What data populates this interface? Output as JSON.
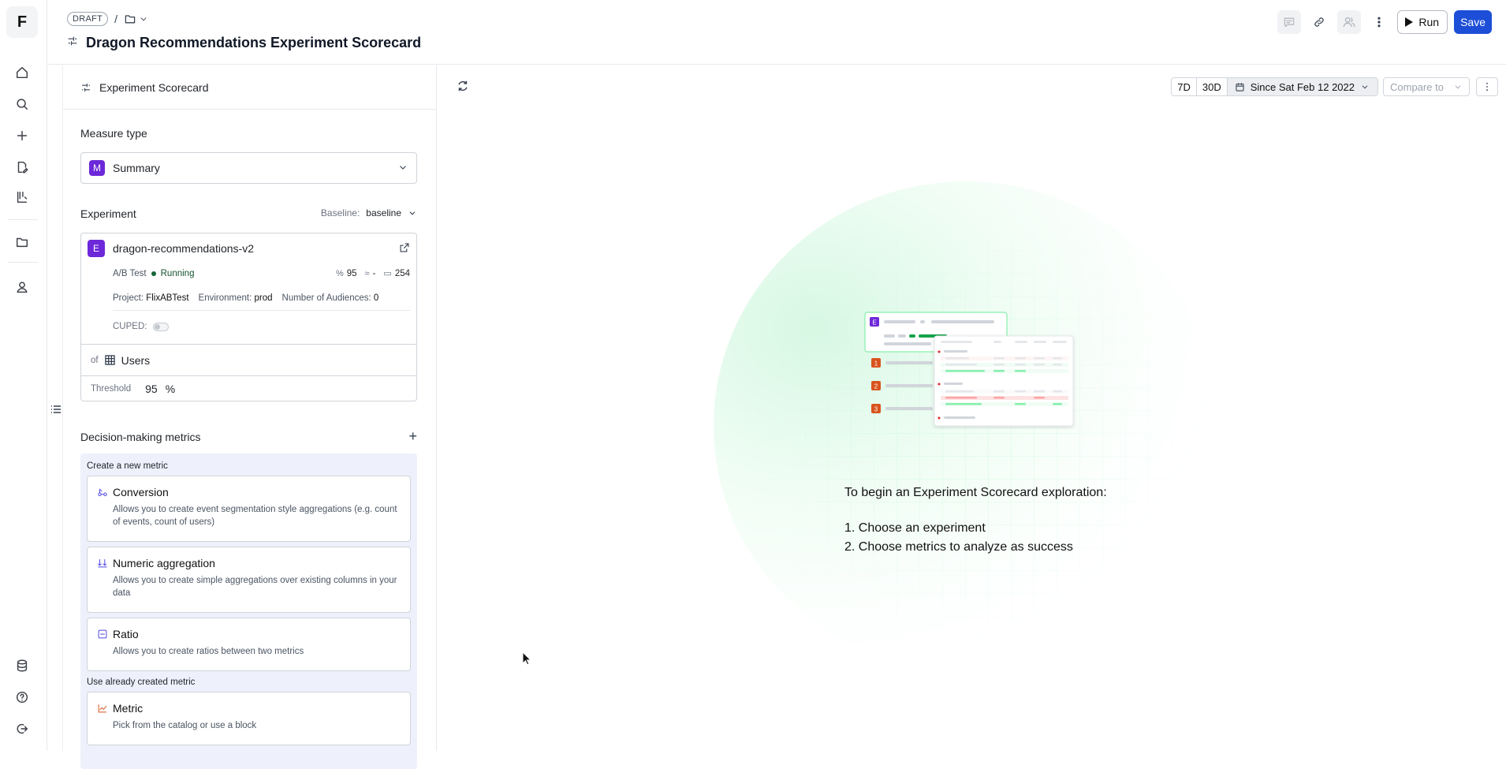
{
  "nav": {
    "logo": "F",
    "items": [
      "home-icon",
      "search-icon",
      "plus-icon",
      "edit-doc-icon",
      "experiments-icon",
      "folder-icon",
      "user-icon"
    ],
    "bottom": [
      "database-icon",
      "help-icon",
      "logout-icon"
    ]
  },
  "header": {
    "draft_label": "DRAFT",
    "separator": "/",
    "title": "Dragon Recommendations Experiment Scorecard",
    "run_label": "Run",
    "save_label": "Save"
  },
  "sidebar": {
    "header_title": "Experiment Scorecard",
    "measure_type_label": "Measure type",
    "measure_badge": "M",
    "measure_value": "Summary",
    "experiment_label": "Experiment",
    "baseline_label": "Baseline:",
    "baseline_value": "baseline",
    "experiment": {
      "badge": "E",
      "name": "dragon-recommendations-v2",
      "type": "A/B Test",
      "status": "Running",
      "confidence": "95",
      "approx": "-",
      "days": "254",
      "project_label": "Project:",
      "project": "FlixABTest",
      "environment_label": "Environment:",
      "environment": "prod",
      "audiences_label": "Number of Audiences:",
      "audiences": "0",
      "cuped_label": "CUPED:"
    },
    "of_label": "of",
    "of_value": "Users",
    "threshold_label": "Threshold",
    "threshold_value": "95",
    "threshold_unit": "%",
    "decision_label": "Decision-making metrics",
    "add_symbol": "+",
    "create_label": "Create a new metric",
    "existing_label": "Use already created metric",
    "metrics": [
      {
        "title": "Conversion",
        "desc": "Allows you to create event segmentation style aggregations (e.g. count of events, count of users)"
      },
      {
        "title": "Numeric aggregation",
        "desc": "Allows you to create simple aggregations over existing columns in your data"
      },
      {
        "title": "Ratio",
        "desc": "Allows you to create ratios between two metrics"
      },
      {
        "title": "Metric",
        "desc": "Pick from the catalog or use a block"
      }
    ]
  },
  "toolbar": {
    "range_7d": "7D",
    "range_30d": "30D",
    "since": "Since Sat Feb 12 2022",
    "compare": "Compare to"
  },
  "empty_state": {
    "lead": "To begin an Experiment Scorecard exploration:",
    "step1": "1. Choose an experiment",
    "step2": "2. Choose metrics to analyze as success",
    "illu_badges": [
      "E",
      "1",
      "2",
      "3"
    ]
  },
  "colors": {
    "accent": "#1d4ed8",
    "purple": "#6d28d9",
    "running": "#166534",
    "glow": "#86efac",
    "orange": "#d9541e"
  }
}
